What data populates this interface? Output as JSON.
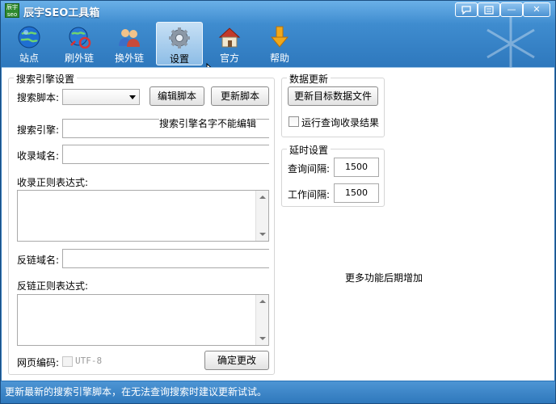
{
  "window": {
    "title": "辰宇SEO工具箱",
    "logo_text": "辰宇 seo"
  },
  "title_buttons": {
    "chat_icon": "speech-bubble-icon",
    "menu_icon": "menu-icon",
    "minimize_glyph": "—",
    "close_glyph": "✕"
  },
  "toolbar": {
    "items": [
      {
        "label": "站点",
        "icon": "globe-icon"
      },
      {
        "label": "刷外链",
        "icon": "globe-link-icon"
      },
      {
        "label": "换外链",
        "icon": "people-icon"
      },
      {
        "label": "设置",
        "icon": "gear-icon"
      },
      {
        "label": "官方",
        "icon": "house-icon"
      },
      {
        "label": "帮助",
        "icon": "arrow-down-icon"
      }
    ],
    "active": "设置"
  },
  "engine_group": {
    "title": "搜索引擎设置",
    "script_label": "搜索脚本:",
    "script_value": "",
    "edit_script_button": "编辑脚本",
    "update_script_button": "更新脚本",
    "engine_label": "搜索引擎:",
    "engine_value": "",
    "engine_note": "搜索引擎名字不能编辑",
    "index_domain_label": "收录域名:",
    "index_domain_value": "",
    "index_regex_label": "收录正则表达式:",
    "index_regex_value": "",
    "backlink_domain_label": "反链域名:",
    "backlink_domain_value": "",
    "backlink_regex_label": "反链正则表达式:",
    "backlink_regex_value": "",
    "encoding_label": "网页编码:",
    "encoding_option": "UTF-8",
    "confirm_button": "确定更改"
  },
  "data_update_group": {
    "title": "数据更新",
    "update_target_button": "更新目标数据文件",
    "run_query_checkbox": "运行查询收录结果",
    "run_query_checked": false
  },
  "delay_group": {
    "title": "延时设置",
    "query_interval_label": "查询间隔:",
    "query_interval_value": "1500",
    "work_interval_label": "工作间隔:",
    "work_interval_value": "1500"
  },
  "more_features_text": "更多功能后期增加",
  "status_bar": {
    "message": "更新最新的搜索引擎脚本，在无法查询搜索时建议更新试试。"
  }
}
